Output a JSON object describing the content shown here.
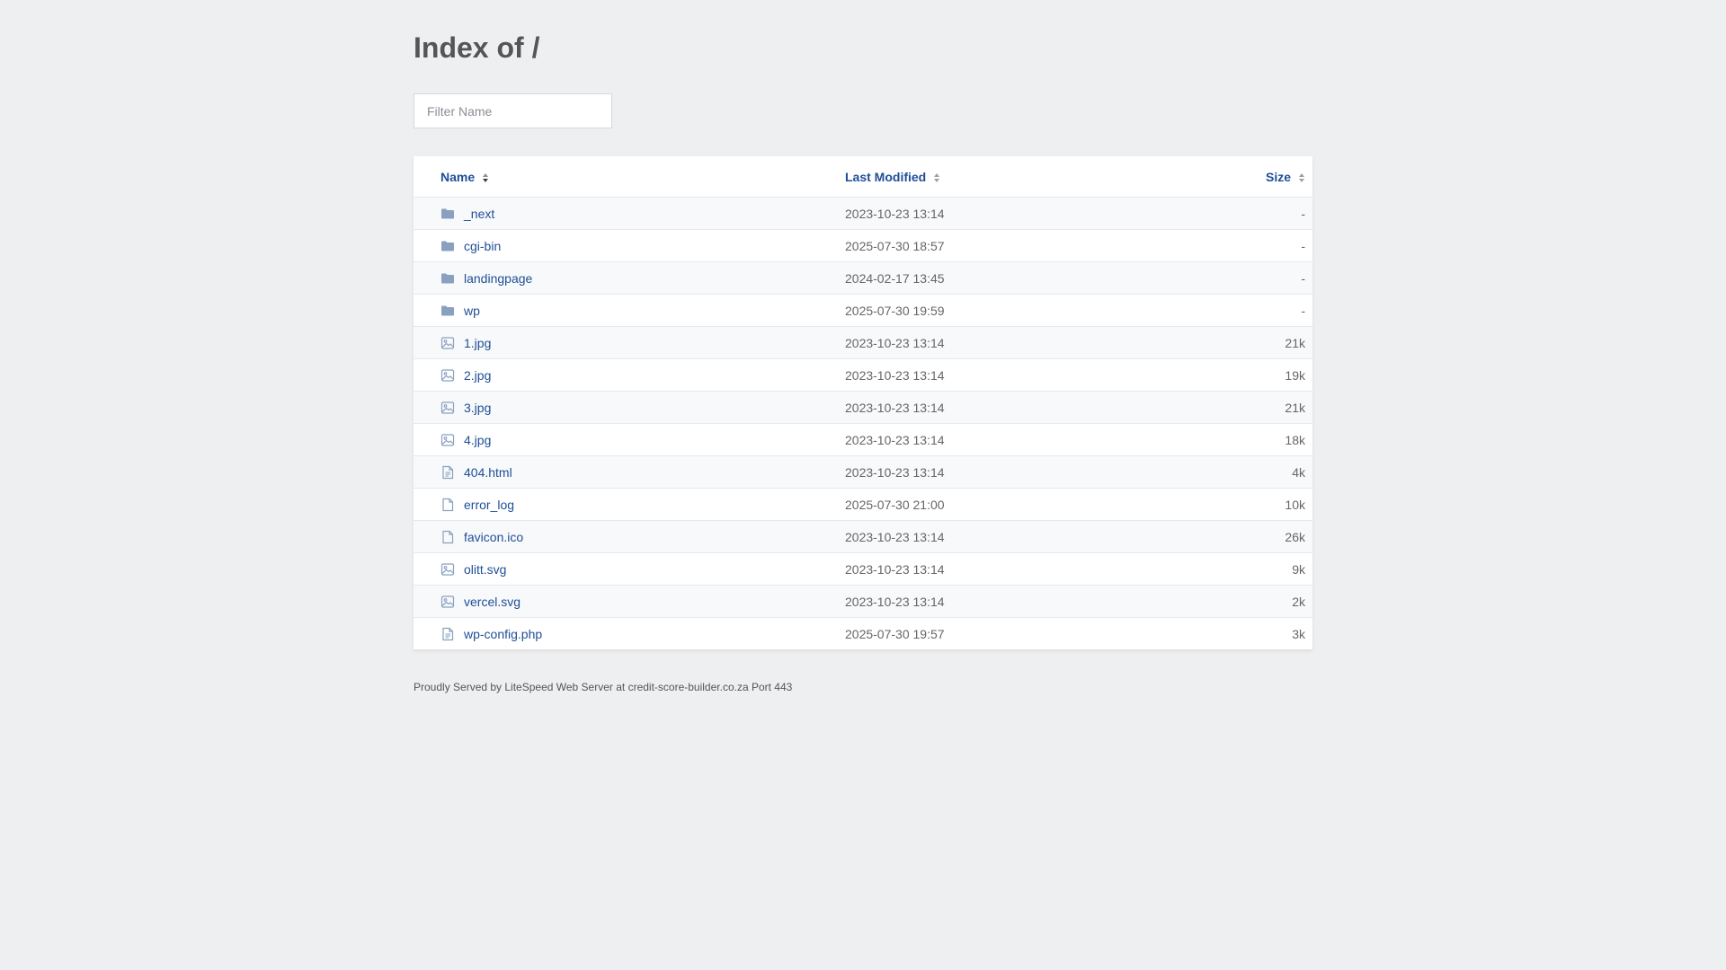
{
  "page": {
    "title": "Index of /"
  },
  "filter": {
    "placeholder": "Filter Name",
    "value": ""
  },
  "table": {
    "headers": {
      "name": "Name",
      "modified": "Last Modified",
      "size": "Size"
    },
    "rows": [
      {
        "name": "_next",
        "modified": "2023-10-23 13:14",
        "size": "-",
        "icon": "folder-icon"
      },
      {
        "name": "cgi-bin",
        "modified": "2025-07-30 18:57",
        "size": "-",
        "icon": "folder-icon"
      },
      {
        "name": "landingpage",
        "modified": "2024-02-17 13:45",
        "size": "-",
        "icon": "folder-icon"
      },
      {
        "name": "wp",
        "modified": "2025-07-30 19:59",
        "size": "-",
        "icon": "folder-icon"
      },
      {
        "name": "1.jpg",
        "modified": "2023-10-23 13:14",
        "size": "21k",
        "icon": "image-icon"
      },
      {
        "name": "2.jpg",
        "modified": "2023-10-23 13:14",
        "size": "19k",
        "icon": "image-icon"
      },
      {
        "name": "3.jpg",
        "modified": "2023-10-23 13:14",
        "size": "21k",
        "icon": "image-icon"
      },
      {
        "name": "4.jpg",
        "modified": "2023-10-23 13:14",
        "size": "18k",
        "icon": "image-icon"
      },
      {
        "name": "404.html",
        "modified": "2023-10-23 13:14",
        "size": "4k",
        "icon": "text-file-icon"
      },
      {
        "name": "error_log",
        "modified": "2025-07-30 21:00",
        "size": "10k",
        "icon": "file-icon"
      },
      {
        "name": "favicon.ico",
        "modified": "2023-10-23 13:14",
        "size": "26k",
        "icon": "file-icon"
      },
      {
        "name": "olitt.svg",
        "modified": "2023-10-23 13:14",
        "size": "9k",
        "icon": "image-icon"
      },
      {
        "name": "vercel.svg",
        "modified": "2023-10-23 13:14",
        "size": "2k",
        "icon": "image-icon"
      },
      {
        "name": "wp-config.php",
        "modified": "2025-07-30 19:57",
        "size": "3k",
        "icon": "text-file-icon"
      }
    ]
  },
  "footer": {
    "text": "Proudly Served by LiteSpeed Web Server at credit-score-builder.co.za Port 443"
  },
  "colors": {
    "background": "#eeeff1",
    "link": "#1f4e98",
    "icon": "#8aa0c0",
    "text": "#555555"
  }
}
